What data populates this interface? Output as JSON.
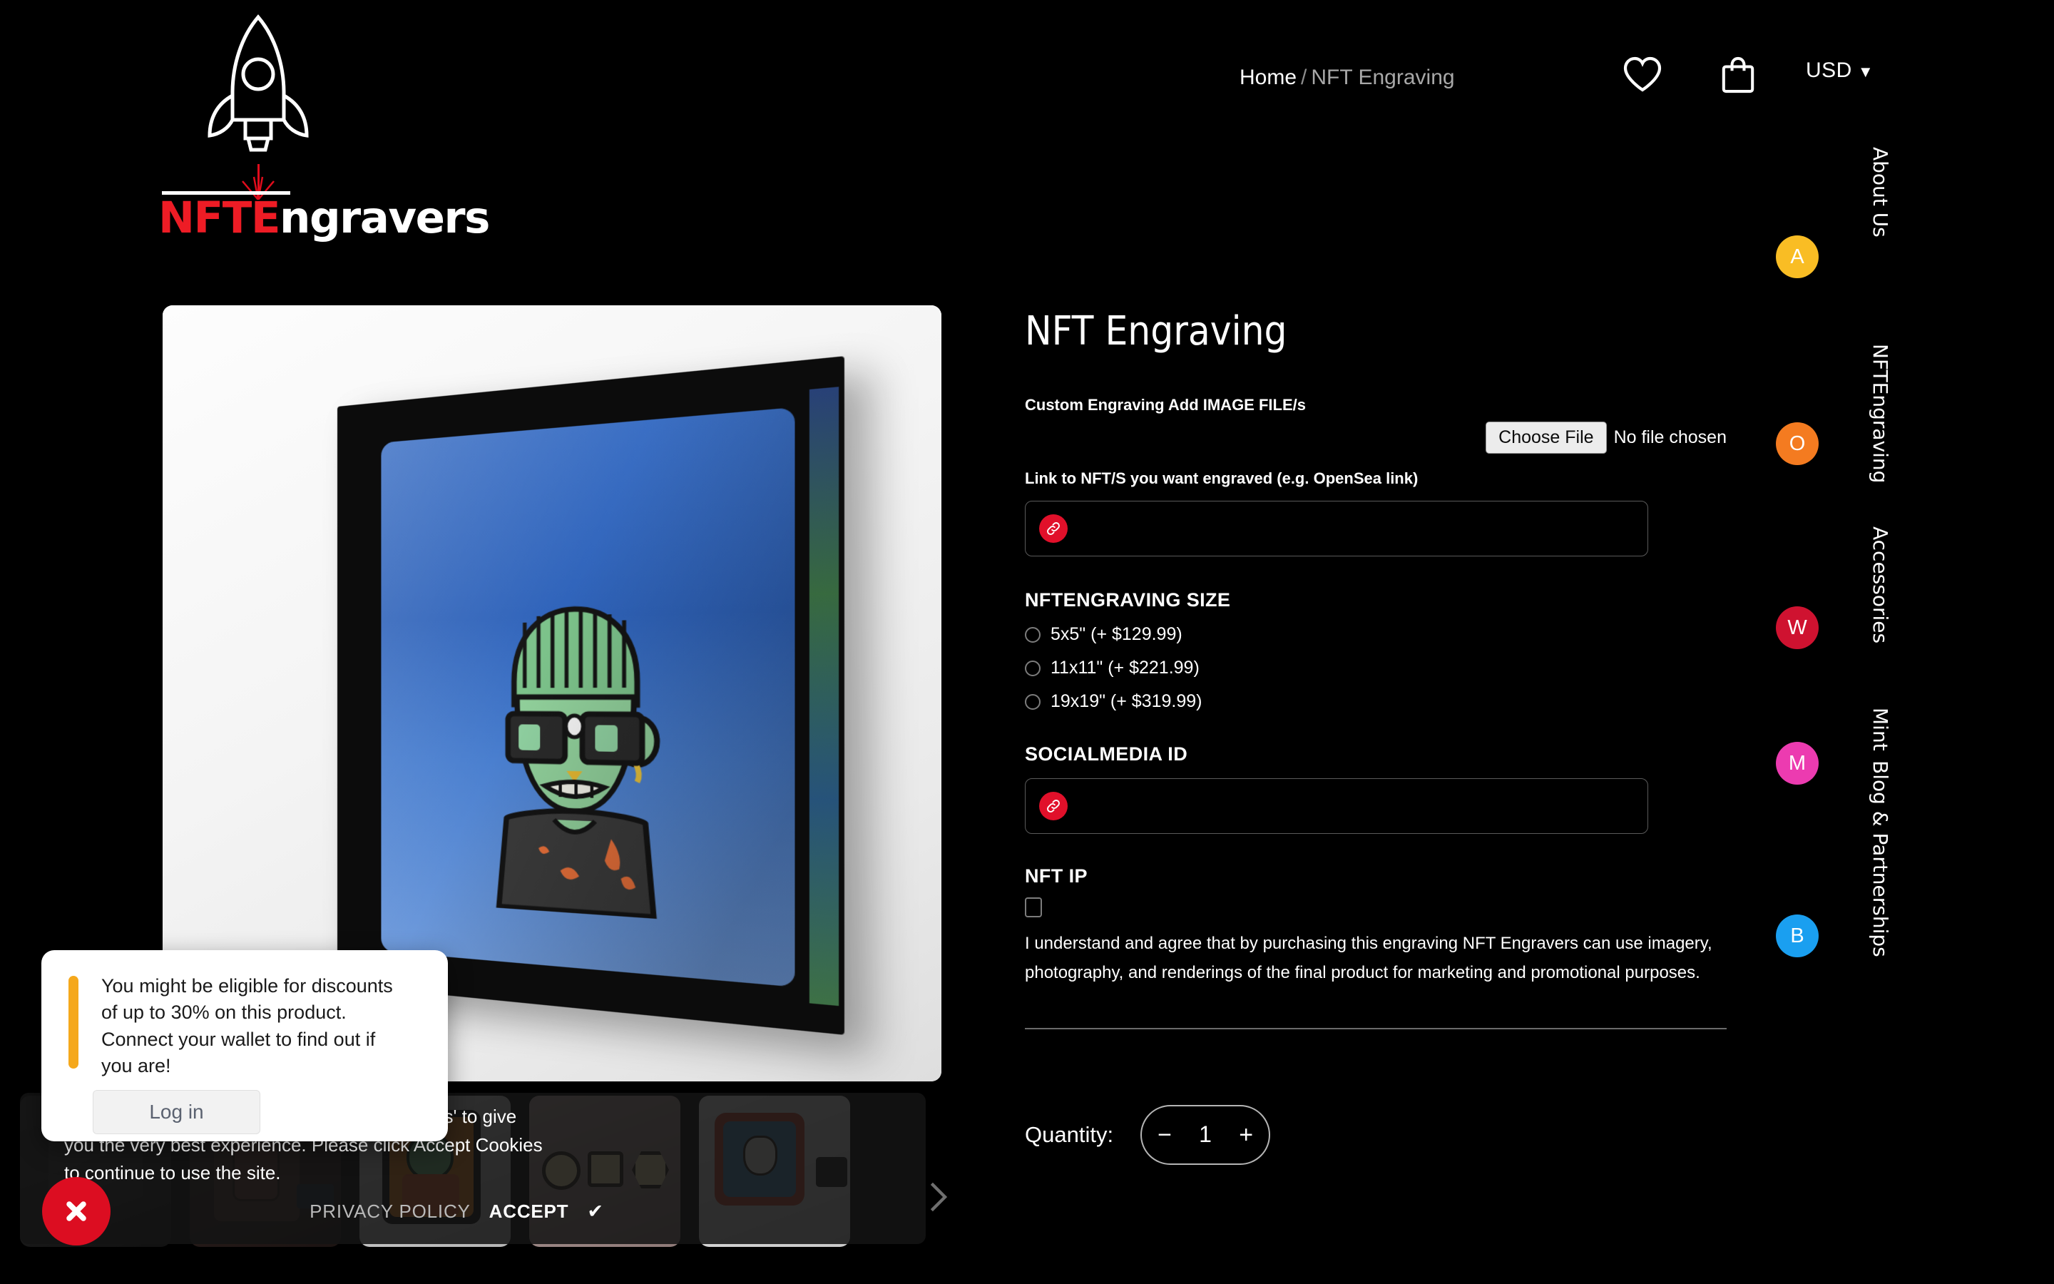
{
  "brand": {
    "name_red": "NFTE",
    "name_white": "ngravers",
    "logo_icon": "rocket-laser-icon"
  },
  "header": {
    "breadcrumb": {
      "home": "Home",
      "separator": "/",
      "current": "NFT Engraving"
    },
    "wishlist_icon": "heart-icon",
    "cart_icon": "shopping-bag-icon",
    "currency": "USD",
    "currency_caret": "▼"
  },
  "gallery": {
    "main_image_alt": "Framed green Frankenstein NFT engraving on white wall",
    "thumbnails": [
      {
        "alt": "Dark framed NFT engraving thumbnail"
      },
      {
        "alt": "Rabbit NFT engraving thumbnail"
      },
      {
        "alt": "Orange background green character NFT engraving thumbnail"
      },
      {
        "alt": "Three coin and plaque engravings on tan backdrop"
      },
      {
        "alt": "Blue cat NFT portrait in red frame with black stand"
      }
    ],
    "next_icon": "chevron-right-icon"
  },
  "product": {
    "title": "NFT Engraving",
    "file_field": {
      "label": "Custom Engraving Add IMAGE FILE/s",
      "button": "Choose File",
      "status": "No file chosen"
    },
    "nft_link_field": {
      "label": "Link to NFT/S you want engraved (e.g. OpenSea link)",
      "value": "",
      "icon": "link-icon"
    },
    "size": {
      "heading": "NFTENGRAVING SIZE",
      "options": [
        {
          "label": "5x5\" (+ $129.99)",
          "selected": false
        },
        {
          "label": "11x11\" (+ $221.99)",
          "selected": false
        },
        {
          "label": "19x19\" (+ $319.99)",
          "selected": false
        }
      ]
    },
    "social_field": {
      "heading": "SOCIALMEDIA ID",
      "value": "",
      "icon": "link-icon"
    },
    "nft_ip": {
      "heading": "NFT IP",
      "checked": false,
      "consent": "I understand and agree that by purchasing this engraving NFT Engravers can use imagery, photography, and renderings of the final product for marketing and promotional purposes."
    },
    "quantity": {
      "label": "Quantity:",
      "minus": "−",
      "value": "1",
      "plus": "+"
    }
  },
  "side_nav": [
    {
      "initial": "A",
      "label": "About Us",
      "color": "#f9bd24"
    },
    {
      "initial": "O",
      "label": "NFTEngraving",
      "color": "#f47b20"
    },
    {
      "initial": "W",
      "label": "Accessories",
      "color": "#cf1230"
    },
    {
      "initial": "M",
      "label": "Mint",
      "color": "#ec3bb0"
    },
    {
      "initial": "B",
      "label": "Blog & Partnerships",
      "color": "#1a9ff0"
    }
  ],
  "cookie_banner": {
    "text": "This website uses cookies including 'all cookies' to give you the very best experience. Please click Accept Cookies to continue to use the site.",
    "privacy_label": "PRIVACY POLICY",
    "accept_label": "ACCEPT",
    "accept_check": "✔",
    "close_icon": "close-x-icon"
  },
  "discount_popup": {
    "message": "You might be eligible for discounts of up to 30% on this product. Connect your wallet to find out if you are!",
    "button": "Log in",
    "accent_color": "#f5a81c"
  }
}
